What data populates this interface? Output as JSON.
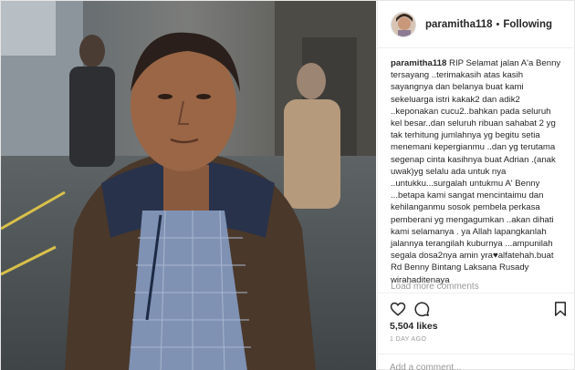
{
  "post": {
    "username": "paramitha118",
    "separator": "•",
    "follow_label": "Following",
    "caption_lines": [
      "RIP Selamat jalan A'a Benny",
      "tersayang ..terimakasih atas kasih",
      "sayangnya dan belanya buat kami",
      "sekeluarga istri kakak2 dan adik2",
      "..keponakan cucu2..bahkan pada seluruh",
      "kel besar..dan seluruh ribuan sahabat 2 yg",
      "tak terhitung jumlahnya yg begitu setia",
      "menemani kepergianmu ..dan yg terutama",
      "segenap cinta kasihnya buat Adrian .(anak",
      "uwak)yg selalu ada untuk nya",
      "..untukku...surgalah untukmu A' Benny",
      "...betapa kami sangat mencintaimu dan",
      "kehilanganmu sosok pembela perkasa",
      "pemberani yg mengagumkan ..akan dihati",
      "kami selamanya . ya Allah lapangkanlah",
      "jalannya terangilah kuburnya ...ampunilah",
      "segala dosa2nya amin yra♥alfatehah.buat",
      "Rd Benny Bintang Laksana Rusady",
      "wirahaditenaya"
    ],
    "load_more_label": "Load more comments",
    "likes": "5,504 likes",
    "time_ago": "1 DAY AGO",
    "comment_placeholder": "Add a comment...",
    "icons": {
      "like": "heart-icon",
      "comment": "comment-bubble-icon",
      "save": "bookmark-icon",
      "options": "more-options-icon"
    }
  }
}
